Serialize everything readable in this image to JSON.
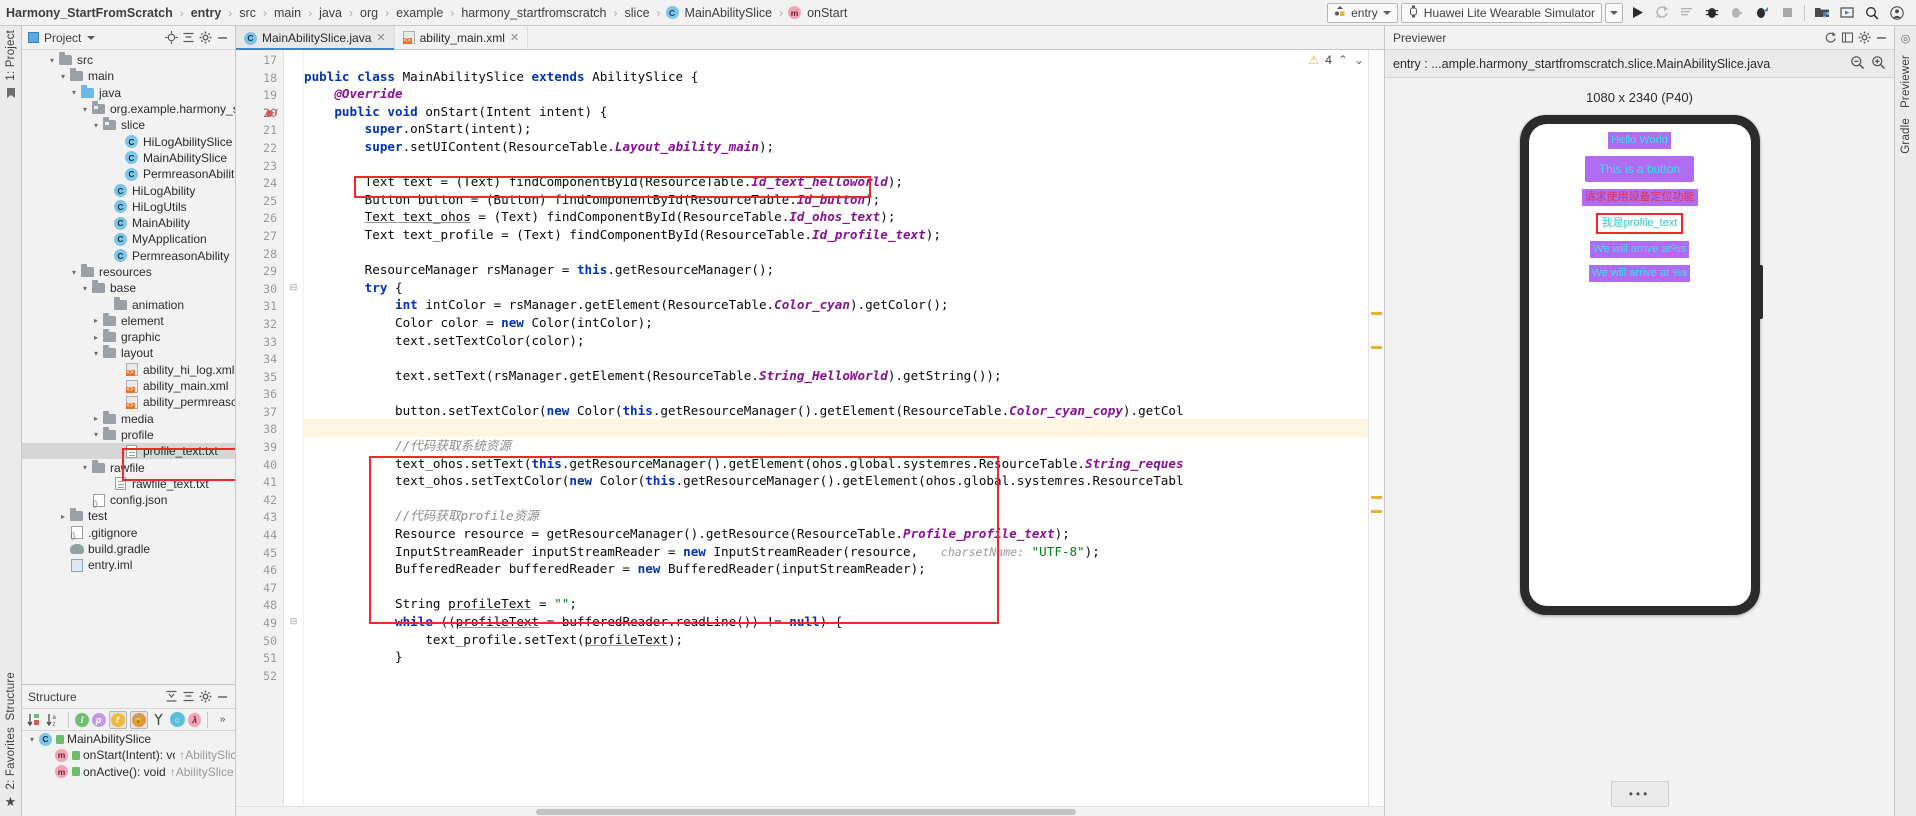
{
  "breadcrumb": {
    "items": [
      {
        "label": "Harmony_StartFromScratch",
        "bold": true,
        "icon": ""
      },
      {
        "label": "entry",
        "bold": true,
        "icon": ""
      },
      {
        "label": "src",
        "bold": false,
        "icon": ""
      },
      {
        "label": "main",
        "bold": false,
        "icon": ""
      },
      {
        "label": "java",
        "bold": false,
        "icon": ""
      },
      {
        "label": "org",
        "bold": false,
        "icon": ""
      },
      {
        "label": "example",
        "bold": false,
        "icon": ""
      },
      {
        "label": "harmony_startfromscratch",
        "bold": false,
        "icon": ""
      },
      {
        "label": "slice",
        "bold": false,
        "icon": ""
      },
      {
        "label": "MainAbilitySlice",
        "bold": false,
        "icon": "class-icon"
      },
      {
        "label": "onStart",
        "bold": false,
        "icon": "method-icon"
      }
    ],
    "separator": "›"
  },
  "toolbar": {
    "run_config": "entry",
    "device": "Huawei Lite Wearable Simulator",
    "icons": [
      {
        "name": "run-icon"
      },
      {
        "name": "apply-changes-icon"
      },
      {
        "name": "run-with-coverage-icon"
      },
      {
        "name": "debug-icon"
      },
      {
        "name": "attach-debugger-icon"
      },
      {
        "name": "profiler-icon"
      },
      {
        "name": "stop-icon"
      },
      {
        "name": "project-structure-icon"
      },
      {
        "name": "device-manager-icon"
      },
      {
        "name": "search-icon"
      },
      {
        "name": "account-icon"
      }
    ]
  },
  "left_rail": {
    "top_label": "1: Project",
    "bottom_labels": [
      "Structure",
      "2: Favorites"
    ]
  },
  "right_rail": {
    "labels": [
      "Previewer",
      "Gradle"
    ]
  },
  "project_panel": {
    "title": "Project",
    "header_icons": [
      "locate-icon",
      "collapse-all-icon",
      "settings-icon",
      "minimize-icon"
    ],
    "tree": [
      {
        "label": "src",
        "indent": 2,
        "arrow": "v",
        "icon": "folder"
      },
      {
        "label": "main",
        "indent": 3,
        "arrow": "v",
        "icon": "folder"
      },
      {
        "label": "java",
        "indent": 4,
        "arrow": "v",
        "icon": "folder-blue"
      },
      {
        "label": "org.example.harmony_s",
        "indent": 5,
        "arrow": "v",
        "icon": "package"
      },
      {
        "label": "slice",
        "indent": 6,
        "arrow": "v",
        "icon": "package"
      },
      {
        "label": "HiLogAbilitySlice",
        "indent": 8,
        "arrow": "",
        "icon": "class"
      },
      {
        "label": "MainAbilitySlice",
        "indent": 8,
        "arrow": "",
        "icon": "class"
      },
      {
        "label": "PermreasonAbilit",
        "indent": 8,
        "arrow": "",
        "icon": "class"
      },
      {
        "label": "HiLogAbility",
        "indent": 7,
        "arrow": "",
        "icon": "class"
      },
      {
        "label": "HiLogUtils",
        "indent": 7,
        "arrow": "",
        "icon": "class"
      },
      {
        "label": "MainAbility",
        "indent": 7,
        "arrow": "",
        "icon": "class"
      },
      {
        "label": "MyApplication",
        "indent": 7,
        "arrow": "",
        "icon": "class"
      },
      {
        "label": "PermreasonAbility",
        "indent": 7,
        "arrow": "",
        "icon": "class"
      },
      {
        "label": "resources",
        "indent": 4,
        "arrow": "v",
        "icon": "folder-res"
      },
      {
        "label": "base",
        "indent": 5,
        "arrow": "v",
        "icon": "folder"
      },
      {
        "label": "animation",
        "indent": 7,
        "arrow": "",
        "icon": "folder"
      },
      {
        "label": "element",
        "indent": 6,
        "arrow": ">",
        "icon": "folder"
      },
      {
        "label": "graphic",
        "indent": 6,
        "arrow": ">",
        "icon": "folder"
      },
      {
        "label": "layout",
        "indent": 6,
        "arrow": "v",
        "icon": "folder"
      },
      {
        "label": "ability_hi_log.xml",
        "indent": 8,
        "arrow": "",
        "icon": "xml"
      },
      {
        "label": "ability_main.xml",
        "indent": 8,
        "arrow": "",
        "icon": "xml"
      },
      {
        "label": "ability_permreasc",
        "indent": 8,
        "arrow": "",
        "icon": "xml"
      },
      {
        "label": "media",
        "indent": 6,
        "arrow": ">",
        "icon": "folder"
      },
      {
        "label": "profile",
        "indent": 6,
        "arrow": "v",
        "icon": "folder"
      },
      {
        "label": "profile_text.txt",
        "indent": 8,
        "arrow": "",
        "icon": "file",
        "selected": true
      },
      {
        "label": "rawfile",
        "indent": 5,
        "arrow": "v",
        "icon": "folder"
      },
      {
        "label": "rawfile_text.txt",
        "indent": 7,
        "arrow": "",
        "icon": "file"
      },
      {
        "label": "config.json",
        "indent": 5,
        "arrow": "",
        "icon": "json"
      },
      {
        "label": "test",
        "indent": 3,
        "arrow": ">",
        "icon": "folder"
      },
      {
        "label": ".gitignore",
        "indent": 3,
        "arrow": "",
        "icon": "json"
      },
      {
        "label": "build.gradle",
        "indent": 3,
        "arrow": "",
        "icon": "gradle"
      },
      {
        "label": "entry.iml",
        "indent": 3,
        "arrow": "",
        "icon": "iml"
      }
    ]
  },
  "structure_panel": {
    "title": "Structure",
    "header_icons": [
      "expand-all-icon",
      "collapse-all-icon",
      "settings-icon",
      "minimize-icon"
    ],
    "toolbar_icons": [
      {
        "name": "sort-by-visibility-icon",
        "label": "↓"
      },
      {
        "name": "sort-alphabetically-icon",
        "label": "↓"
      },
      {
        "name": "show-inherited-icon",
        "label": "I"
      },
      {
        "name": "show-properties-icon",
        "label": "p"
      },
      {
        "name": "show-fields-icon",
        "label": "f"
      },
      {
        "name": "show-non-public-icon",
        "label": "■"
      },
      {
        "name": "show-anonymous-icon",
        "label": "Y"
      },
      {
        "name": "group-icon",
        "label": "●"
      },
      {
        "name": "show-lambdas-icon",
        "label": "λ"
      },
      {
        "name": "more-icon",
        "label": "»"
      }
    ],
    "tree": [
      {
        "label": "MainAbilitySlice",
        "suffix": "",
        "indent": 0,
        "arrow": "v",
        "icon": "class"
      },
      {
        "label": "onStart(Intent): void",
        "suffix": "↑AbilitySlice",
        "indent": 1,
        "arrow": "",
        "icon": "method"
      },
      {
        "label": "onActive(): void",
        "suffix": "↑AbilitySlice",
        "indent": 1,
        "arrow": "",
        "icon": "method"
      }
    ]
  },
  "editor": {
    "tabs": [
      {
        "label": "MainAbilitySlice.java",
        "icon": "class-icon",
        "active": true,
        "close": "✕"
      },
      {
        "label": "ability_main.xml",
        "icon": "xml-icon",
        "active": false,
        "close": "✕"
      }
    ],
    "inspection": {
      "warning_count": "4",
      "warning_icon": "warning-triangle-icon",
      "up": "⌃",
      "down": "⌄"
    },
    "first_line_number": 17,
    "lines": [
      {
        "n": 17,
        "html": ""
      },
      {
        "n": 18,
        "html": "<span class=\"k\">public class</span> MainAbilitySlice <span class=\"k\">extends</span> AbilitySlice {"
      },
      {
        "n": 19,
        "html": "    <span class=\"f\">@Override</span>"
      },
      {
        "n": 20,
        "html": "    <span class=\"k\">public void</span> onStart(Intent intent) {",
        "bp": true
      },
      {
        "n": 21,
        "html": "        <span class=\"k\">super</span>.onStart(intent);"
      },
      {
        "n": 22,
        "html": "        <span class=\"k\">super</span>.setUIContent(ResourceTable.<span class=\"f\">Layout_ability_main</span>);"
      },
      {
        "n": 23,
        "html": ""
      },
      {
        "n": 24,
        "html": "        Text text = (Text) findComponentById(ResourceTable.<span class=\"f\">Id_text_helloworld</span>);"
      },
      {
        "n": 25,
        "html": "        Button button = (Button) findComponentById(ResourceTable.<span class=\"f\">Id_button</span>);"
      },
      {
        "n": 26,
        "html": "        <span class=\"ul\">Text text_ohos</span> = (Text) findComponentById(ResourceTable.<span class=\"f\">Id_ohos_text</span>);"
      },
      {
        "n": 27,
        "html": "        Text text_profile = (Text) findComponentById(ResourceTable.<span class=\"f\">Id_profile_text</span>);"
      },
      {
        "n": 28,
        "html": ""
      },
      {
        "n": 29,
        "html": "        ResourceManager rsManager = <span class=\"k\">this</span>.getResourceManager();"
      },
      {
        "n": 30,
        "html": "        <span class=\"k\">try</span> {",
        "fold": true
      },
      {
        "n": 31,
        "html": "            <span class=\"k\">int</span> intColor = rsManager.getElement(ResourceTable.<span class=\"f\">Color_cyan</span>).getColor();"
      },
      {
        "n": 32,
        "html": "            Color color = <span class=\"k\">new</span> Color(intColor);"
      },
      {
        "n": 33,
        "html": "            text.setTextColor(color);"
      },
      {
        "n": 34,
        "html": ""
      },
      {
        "n": 35,
        "html": "            text.setText(rsManager.getElement(ResourceTable.<span class=\"f\">String_HelloWorld</span>).getString());"
      },
      {
        "n": 36,
        "html": ""
      },
      {
        "n": 37,
        "html": "            button.setTextColor(<span class=\"k\">new</span> Color(<span class=\"k\">this</span>.getResourceManager().getElement(ResourceTable.<span class=\"f\">Color_cyan_copy</span>).getCol"
      },
      {
        "n": 38,
        "html": "",
        "hi": true
      },
      {
        "n": 39,
        "html": "            <span class=\"cm\">//代码获取系统资源</span>"
      },
      {
        "n": 40,
        "html": "            text_ohos.setText(<span class=\"k\">this</span>.getResourceManager().getElement(ohos.global.systemres.ResourceTable.<span class=\"f\">String_reques</span>"
      },
      {
        "n": 41,
        "html": "            text_ohos.setTextColor(<span class=\"k\">new</span> Color(<span class=\"k\">this</span>.getResourceManager().getElement(ohos.global.systemres.ResourceTabl"
      },
      {
        "n": 42,
        "html": ""
      },
      {
        "n": 43,
        "html": "            <span class=\"cm\">//代码获取profile资源</span>"
      },
      {
        "n": 44,
        "html": "            Resource resource = getResourceManager().getResource(ResourceTable.<span class=\"f\">Profile_profile_text</span>);"
      },
      {
        "n": 45,
        "html": "            InputStreamReader inputStreamReader = <span class=\"k\">new</span> InputStreamReader(resource,   <span class=\"hint\">charsetName:</span> <span class=\"s\">\"UTF-8\"</span>);"
      },
      {
        "n": 46,
        "html": "            BufferedReader bufferedReader = <span class=\"k\">new</span> BufferedReader(inputStreamReader);"
      },
      {
        "n": 47,
        "html": ""
      },
      {
        "n": 48,
        "html": "            String <span class=\"ul\">profileText</span> = <span class=\"s\">\"\"</span>;"
      },
      {
        "n": 49,
        "html": "            <span class=\"k\">while</span> ((<span class=\"ul\">profileText</span> = bufferedReader.readLine()) != <span class=\"k\">null</span>) {",
        "fold": true
      },
      {
        "n": 50,
        "html": "                text_profile.setText(<span class=\"ul\">profileText</span>);"
      },
      {
        "n": 51,
        "html": "            }"
      },
      {
        "n": 52,
        "html": ""
      }
    ]
  },
  "previewer": {
    "title": "Previewer",
    "header_icons": [
      "refresh-icon",
      "hide-icon",
      "settings-icon",
      "minimize-icon"
    ],
    "path": "entry : ...ample.harmony_startfromscratch.slice.MainAbilitySlice.java",
    "zoom_icons": [
      "zoom-out-icon",
      "zoom-in-icon"
    ],
    "resolution": "1080 x 2340 (P40)",
    "device_screen": {
      "items": [
        {
          "text": "Hello World",
          "type": "text",
          "bg": "#b06bf0",
          "fg": "#35e0e8",
          "highlight": false
        },
        {
          "text": "This is a button",
          "type": "button",
          "bg": "#b06bf0",
          "fg": "#35e0e8",
          "highlight": false
        },
        {
          "text": "请求使用设备定位功能",
          "type": "text",
          "bg": "#b06bf0",
          "fg": "#e8304a",
          "highlight": false
        },
        {
          "text": "我是profile_text",
          "type": "text",
          "bg": "#ffffff",
          "fg": "#35c8c8",
          "highlight": true
        },
        {
          "text": "We will arrive at%s",
          "type": "text",
          "bg": "#b06bf0",
          "fg": "#35e0e8",
          "highlight": false
        },
        {
          "text": "We will arrive at %s",
          "type": "text",
          "bg": "#b06bf0",
          "fg": "#35e0e8",
          "highlight": false
        }
      ]
    },
    "more_button": "•••"
  },
  "colors": {
    "accent": "#3d85c6",
    "highlight_red": "#ef2929",
    "keyword": "#0033b3",
    "static_field": "#871094",
    "string": "#067d17",
    "comment": "#8c8c8c",
    "warning": "#e8b230"
  }
}
